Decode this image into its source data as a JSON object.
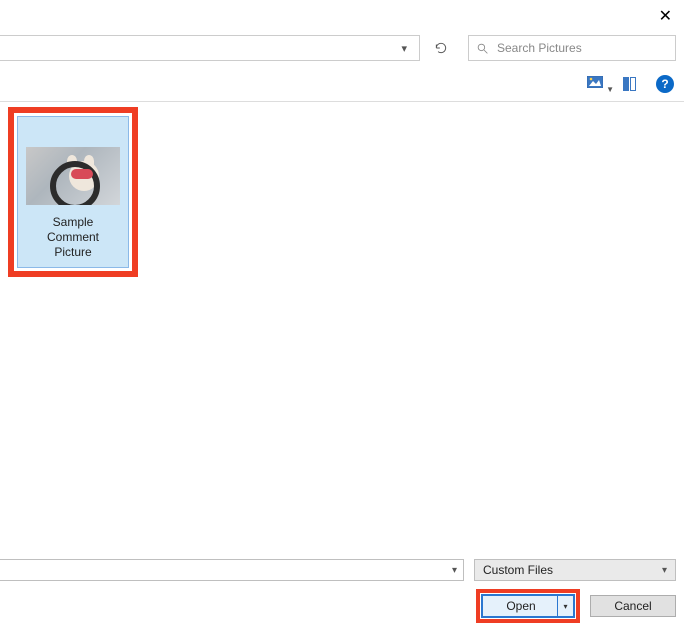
{
  "search": {
    "placeholder": "Search Pictures"
  },
  "file": {
    "label_line1": "Sample",
    "label_line2": "Comment",
    "label_line3": "Picture"
  },
  "filter": {
    "label": "Custom Files"
  },
  "buttons": {
    "open": "Open",
    "cancel": "Cancel"
  },
  "help_glyph": "?"
}
